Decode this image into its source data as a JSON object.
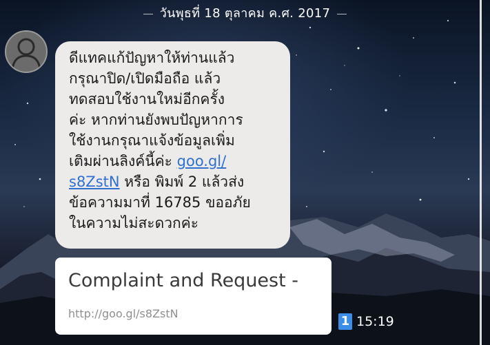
{
  "chat": {
    "date_header": "วันพุธที่ 18 ตุลาคม ค.ศ. 2017"
  },
  "sender": {
    "avatar_icon": "default-user-icon"
  },
  "message": {
    "text_part1": "ดีแทคแก้ปัญหาให้ท่านแล้ว\nกรุณาปิด/เปิดมือถือ แล้ว\nทดสอบใช้งานใหม่อีกครั้ง\nค่ะ  หากท่านยังพบปัญหาการ\nใช้งานกรุณาแจ้งข้อมูลเพิ่ม\nเติมผ่านลิงค์นี้ค่ะ ",
    "link_part1": "goo.gl/",
    "link_part2": "s8ZstN",
    "text_part2": " หรือ พิมพ์ 2 แล้วส่ง\nข้อความมาที่ 16785 ขออภัย\nในความไม่สะดวกค่ะ"
  },
  "link_preview": {
    "title": "Complaint and Request -",
    "url": "http://goo.gl/s8ZstN"
  },
  "status": {
    "read_count": "1",
    "time": "15:19"
  },
  "colors": {
    "bubble": "#ecebea",
    "link": "#2f6fd0",
    "read_badge": "#3a8ee6"
  }
}
